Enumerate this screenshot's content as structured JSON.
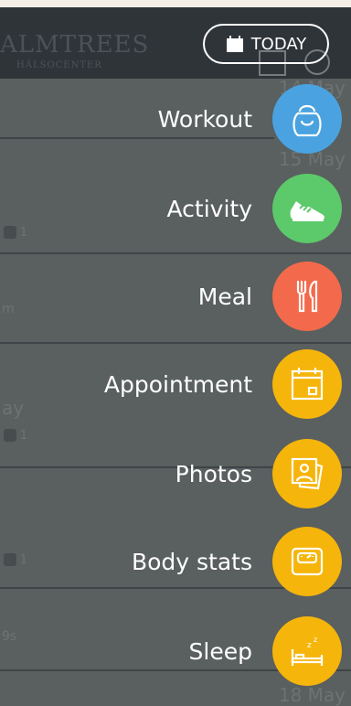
{
  "header": {
    "logo_text": "ALMTREES",
    "logo_subtext": "HÄLSOCENTER",
    "today_label": "TODAY"
  },
  "background_feed": {
    "dates": [
      "14 May",
      "15 May",
      "18 May"
    ],
    "snippets": [
      "m",
      "ay",
      "9s"
    ],
    "comment_counts": [
      "1",
      "1",
      "1"
    ]
  },
  "menu": {
    "items": [
      {
        "label": "Workout",
        "icon": "kettlebell-icon",
        "color": "#4aa3e0"
      },
      {
        "label": "Activity",
        "icon": "sneaker-icon",
        "color": "#5cc96b"
      },
      {
        "label": "Meal",
        "icon": "fork-knife-icon",
        "color": "#f26a4b"
      },
      {
        "label": "Appointment",
        "icon": "calendar-icon",
        "color": "#f5b50a"
      },
      {
        "label": "Photos",
        "icon": "photos-icon",
        "color": "#f5b50a"
      },
      {
        "label": "Body stats",
        "icon": "scale-icon",
        "color": "#f5b50a"
      },
      {
        "label": "Sleep",
        "icon": "bed-icon",
        "color": "#f5b50a"
      }
    ]
  }
}
